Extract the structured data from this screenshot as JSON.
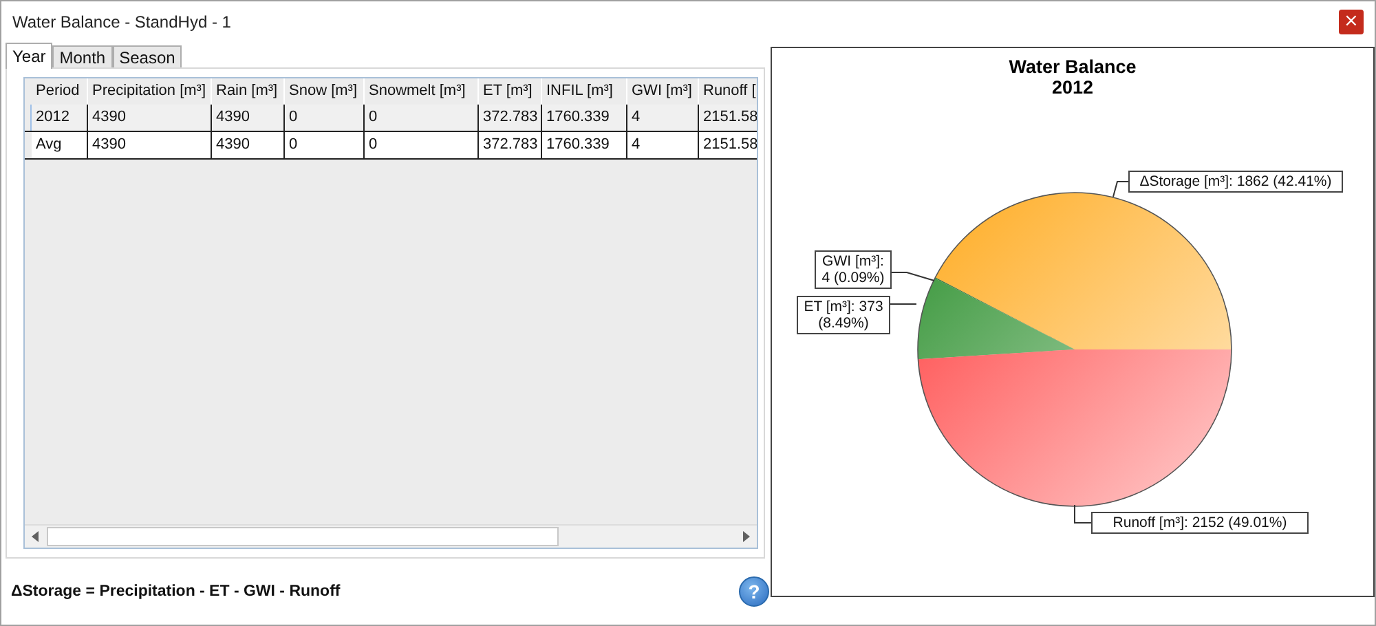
{
  "window": {
    "title": "Water Balance - StandHyd - 1",
    "close": "×"
  },
  "tabs": [
    {
      "label": "Year",
      "selected": true
    },
    {
      "label": "Month",
      "selected": false
    },
    {
      "label": "Season",
      "selected": false
    }
  ],
  "table": {
    "columns": [
      "Period",
      "Precipitation [m³]",
      "Rain [m³]",
      "Snow [m³]",
      "Snowmelt [m³]",
      "ET [m³]",
      "INFIL [m³]",
      "GWI [m³]",
      "Runoff ["
    ],
    "rows": [
      {
        "cells": [
          "2012",
          "4390",
          "4390",
          "0",
          "0",
          "372.783",
          "1760.339",
          "4",
          "2151.58"
        ],
        "selected": true
      },
      {
        "cells": [
          "Avg",
          "4390",
          "4390",
          "0",
          "0",
          "372.783",
          "1760.339",
          "4",
          "2151.58"
        ],
        "selected": false
      }
    ]
  },
  "formula": "ΔStorage = Precipitation - ET - GWI - Runoff",
  "help": "?",
  "chart": {
    "title": "Water Balance",
    "subtitle": "2012",
    "chart_data": {
      "type": "pie",
      "value_labels": [
        "ΔStorage [m³]: 1862 (42.41%)",
        "GWI [m³]: 4 (0.09%)",
        "ET [m³]: 373 (8.49%)",
        "Runoff [m³]: 2152 (49.01%)"
      ],
      "series": [
        {
          "values": [
            42.41,
            0.09,
            8.49,
            49.01
          ],
          "colors": [
            "#ffab20",
            "#1c5a1c",
            "#2f9130",
            "#ff3b3b"
          ]
        }
      ]
    }
  }
}
